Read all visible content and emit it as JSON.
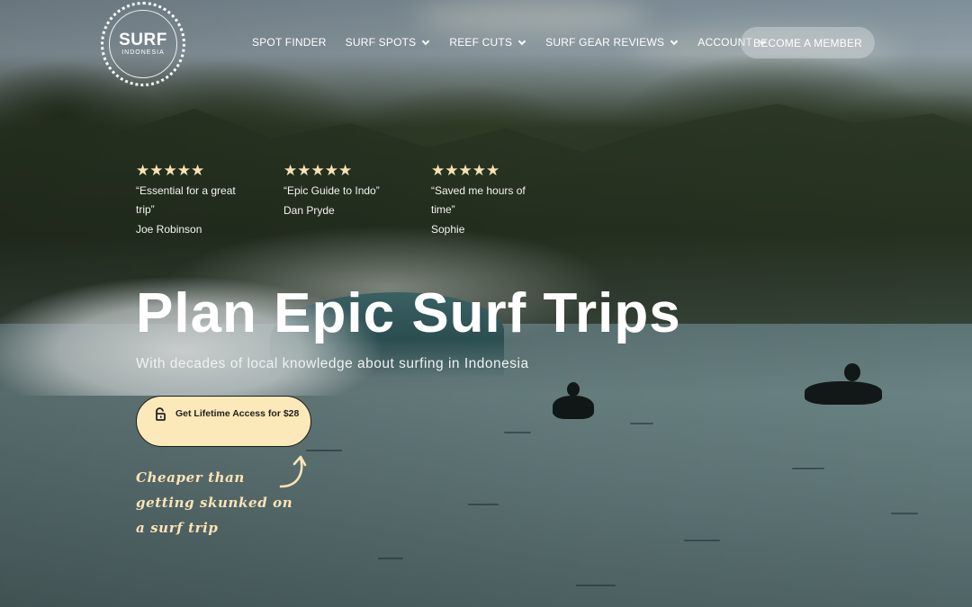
{
  "logo": {
    "main": "SURF",
    "sub": "INDONESIA"
  },
  "nav": {
    "items": [
      {
        "label": "SPOT FINDER",
        "dropdown": false
      },
      {
        "label": "SURF SPOTS",
        "dropdown": true
      },
      {
        "label": "REEF CUTS",
        "dropdown": true
      },
      {
        "label": "SURF GEAR REVIEWS",
        "dropdown": true
      },
      {
        "label": "ACCOUNT",
        "dropdown": true
      }
    ],
    "cta": "BECOME A MEMBER"
  },
  "testimonials": [
    {
      "stars": "★★★★★",
      "rating": 5,
      "quote": "“Essential for a great trip”",
      "author": "Joe Robinson"
    },
    {
      "stars": "★★★★★",
      "rating": 5,
      "quote": "“Epic Guide to Indo”",
      "author": "Dan Pryde"
    },
    {
      "stars": "★★★★★",
      "rating": 5,
      "quote": "“Saved me hours of time”",
      "author": "Sophie"
    }
  ],
  "hero": {
    "title": "Plan Epic Surf Trips",
    "subtitle": "With decades of local knowledge about surfing in Indonesia",
    "cta": "Get Lifetime Access for $28",
    "handwritten_note": "Cheaper than getting skunked on a surf trip"
  },
  "colors": {
    "cta_background": "#fce9b9",
    "star_color": "#f7e2b5",
    "handwriting_color": "#fbe4b6"
  },
  "icons": [
    "lock-open-icon",
    "chevron-down-icon",
    "curved-arrow-icon",
    "star-icon"
  ]
}
